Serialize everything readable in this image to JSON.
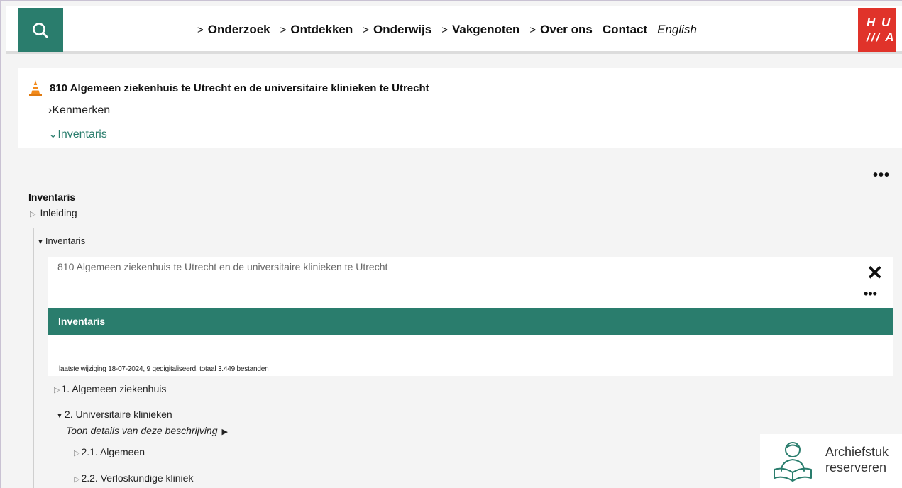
{
  "header": {
    "nav": [
      {
        "label": "Onderzoek",
        "chevron": ">"
      },
      {
        "label": "Ontdekken",
        "chevron": ">"
      },
      {
        "label": "Onderwijs",
        "chevron": ">"
      },
      {
        "label": "Vakgenoten",
        "chevron": ">"
      },
      {
        "label": "Over ons",
        "chevron": ">"
      },
      {
        "label": "Contact"
      }
    ],
    "language": "English",
    "logo": {
      "line1": "H U",
      "line2": "/// A"
    }
  },
  "record": {
    "title": "810  Algemeen ziekenhuis te Utrecht en de universitaire klinieken te Utrecht",
    "links": [
      "›Kenmerken",
      "⌄Inventaris"
    ]
  },
  "tree": {
    "more": "•••",
    "heading": "Inventaris",
    "inleiding": "Inleiding",
    "inventaris_toggle": "Inventaris",
    "panel": {
      "title": "810 Algemeen ziekenhuis te Utrecht en de universitaire klinieken te Utrecht",
      "close": "✕",
      "more": "•••",
      "bar": "Inventaris",
      "meta": "laatste wijziging 18-07-2024, 9 gedigitaliseerd, totaal 3.449 bestanden"
    },
    "nodes": [
      "1. Algemeen ziekenhuis",
      "2. Universitaire klinieken",
      "2.1. Algemeen",
      "2.2. Verloskundige kliniek"
    ],
    "details": "Toon details van deze beschrijving"
  },
  "reserve": {
    "line1": "Archiefstuk",
    "line2": "reserveren"
  },
  "colors": {
    "brand_green": "#2a7d6d",
    "logo_red": "#e0332a"
  }
}
